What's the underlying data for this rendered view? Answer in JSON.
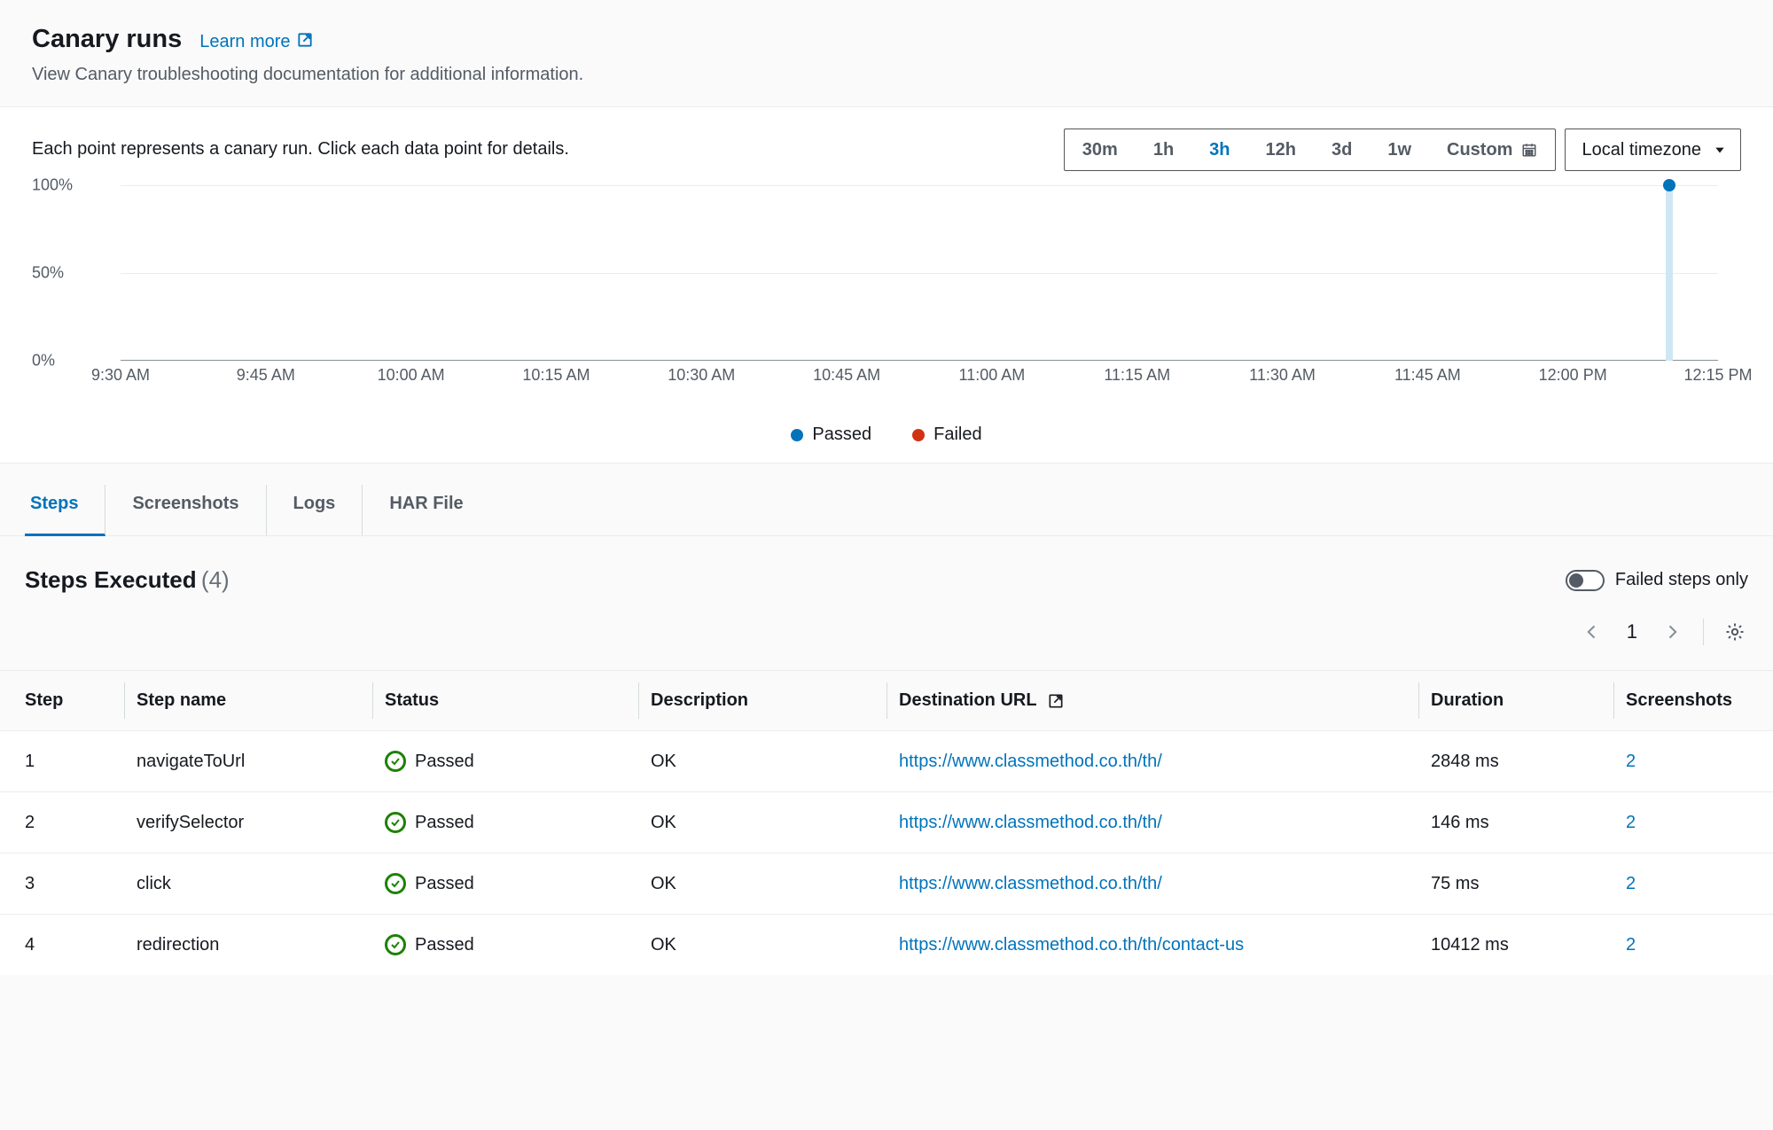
{
  "header": {
    "title": "Canary runs",
    "learn_more": "Learn more",
    "subtitle": "View Canary troubleshooting documentation for additional information."
  },
  "chart": {
    "description": "Each point represents a canary run. Click each data point for details.",
    "time_options": [
      "30m",
      "1h",
      "3h",
      "12h",
      "3d",
      "1w"
    ],
    "time_active_index": 2,
    "custom_label": "Custom",
    "timezone_label": "Local timezone",
    "y_ticks": [
      "100%",
      "50%",
      "0%"
    ],
    "x_ticks": [
      "9:30 AM",
      "9:45 AM",
      "10:00 AM",
      "10:15 AM",
      "10:30 AM",
      "10:45 AM",
      "11:00 AM",
      "11:15 AM",
      "11:30 AM",
      "11:45 AM",
      "12:00 PM",
      "12:15 PM"
    ],
    "legend_passed": "Passed",
    "legend_failed": "Failed"
  },
  "chart_data": {
    "type": "scatter",
    "title": "",
    "xlabel": "",
    "ylabel": "",
    "ylim": [
      0,
      100
    ],
    "x_range_minutes": [
      570,
      735
    ],
    "series": [
      {
        "name": "Passed",
        "color": "#0073bb",
        "points": [
          {
            "x_minutes": 730,
            "x_label": "12:10 PM",
            "y": 100
          }
        ]
      },
      {
        "name": "Failed",
        "color": "#d13212",
        "points": []
      }
    ]
  },
  "tabs": {
    "items": [
      "Steps",
      "Screenshots",
      "Logs",
      "HAR File"
    ],
    "active_index": 0
  },
  "steps_section": {
    "title": "Steps Executed",
    "count_display": "(4)",
    "failed_only_label": "Failed steps only",
    "page_number": "1"
  },
  "table": {
    "headers": {
      "step": "Step",
      "name": "Step name",
      "status": "Status",
      "description": "Description",
      "url": "Destination URL",
      "duration": "Duration",
      "screenshots": "Screenshots"
    },
    "rows": [
      {
        "step": "1",
        "name": "navigateToUrl",
        "status": "Passed",
        "description": "OK",
        "url": "https://www.classmethod.co.th/th/",
        "duration": "2848 ms",
        "screenshots": "2"
      },
      {
        "step": "2",
        "name": "verifySelector",
        "status": "Passed",
        "description": "OK",
        "url": "https://www.classmethod.co.th/th/",
        "duration": "146 ms",
        "screenshots": "2"
      },
      {
        "step": "3",
        "name": "click",
        "status": "Passed",
        "description": "OK",
        "url": "https://www.classmethod.co.th/th/",
        "duration": "75 ms",
        "screenshots": "2"
      },
      {
        "step": "4",
        "name": "redirection",
        "status": "Passed",
        "description": "OK",
        "url": "https://www.classmethod.co.th/th/contact-us",
        "duration": "10412 ms",
        "screenshots": "2"
      }
    ]
  }
}
